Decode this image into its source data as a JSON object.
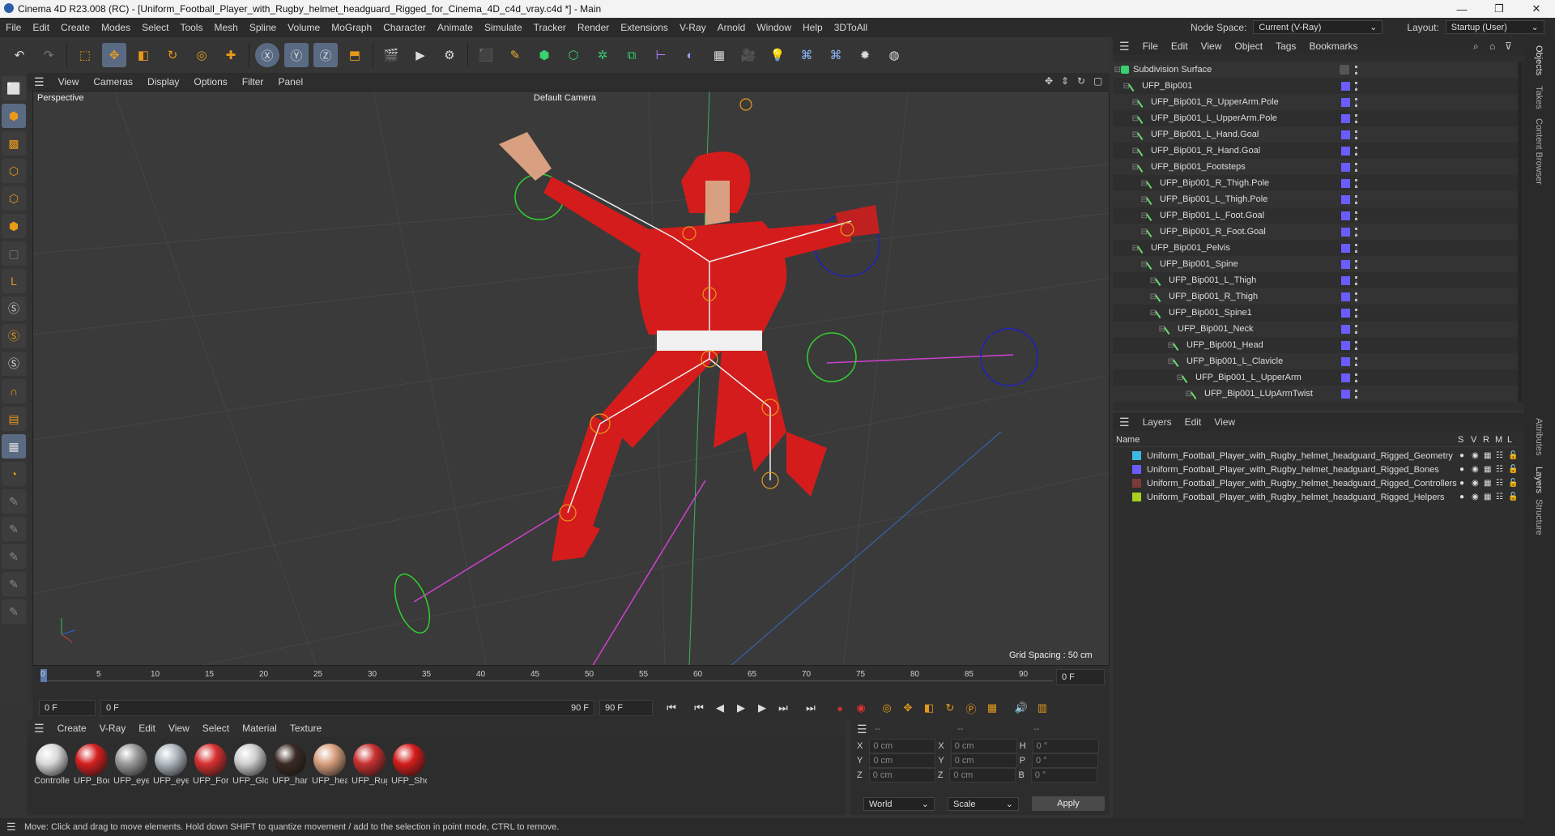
{
  "window": {
    "title": "Cinema 4D R23.008 (RC) - [Uniform_Football_Player_with_Rugby_helmet_headguard_Rigged_for_Cinema_4D_c4d_vray.c4d *] - Main"
  },
  "menu": [
    "File",
    "Edit",
    "Create",
    "Modes",
    "Select",
    "Tools",
    "Mesh",
    "Spline",
    "Volume",
    "MoGraph",
    "Character",
    "Animate",
    "Simulate",
    "Tracker",
    "Render",
    "Extensions",
    "V-Ray",
    "Arnold",
    "Window",
    "Help",
    "3DToAll"
  ],
  "node_space": {
    "label": "Node Space:",
    "value": "Current (V-Ray)"
  },
  "layout": {
    "label": "Layout:",
    "value": "Startup (User)"
  },
  "viewport": {
    "menu": [
      "View",
      "Cameras",
      "Display",
      "Options",
      "Filter",
      "Panel"
    ],
    "mode": "Perspective",
    "camera": "Default Camera",
    "grid_spacing": "Grid Spacing : 50 cm"
  },
  "timeline": {
    "ticks": [
      "0",
      "5",
      "10",
      "15",
      "20",
      "25",
      "30",
      "35",
      "40",
      "45",
      "50",
      "55",
      "60",
      "65",
      "70",
      "75",
      "80",
      "85",
      "90"
    ],
    "current": "0 F"
  },
  "transport": {
    "start": "0 F",
    "preview_start": "0 F",
    "preview_end": "90 F",
    "end": "90 F"
  },
  "materials": {
    "menu": [
      "Create",
      "V-Ray",
      "Edit",
      "View",
      "Select",
      "Material",
      "Texture"
    ],
    "items": [
      {
        "label": "Controlle",
        "color": "#d9d9d9"
      },
      {
        "label": "UFP_Boc",
        "color": "#d42020"
      },
      {
        "label": "UFP_eye",
        "color": "#9a9a9a"
      },
      {
        "label": "UFP_eye",
        "color": "#b0b8c0"
      },
      {
        "label": "UFP_Forr",
        "color": "#d83030"
      },
      {
        "label": "UFP_Glo",
        "color": "#cfcfcf"
      },
      {
        "label": "UFP_han",
        "color": "#3a2a24"
      },
      {
        "label": "UFP_hea",
        "color": "#d8a080"
      },
      {
        "label": "UFP_Rug",
        "color": "#c83030"
      },
      {
        "label": "UFP_Sho",
        "color": "#d41c1c"
      }
    ]
  },
  "coords": {
    "header": [
      "--",
      "--",
      "--"
    ],
    "rows": [
      {
        "a": "X",
        "v1": "0 cm",
        "b": "X",
        "v2": "0 cm",
        "c": "H",
        "v3": "0 °"
      },
      {
        "a": "Y",
        "v1": "0 cm",
        "b": "Y",
        "v2": "0 cm",
        "c": "P",
        "v3": "0 °"
      },
      {
        "a": "Z",
        "v1": "0 cm",
        "b": "Z",
        "v2": "0 cm",
        "c": "B",
        "v3": "0 °"
      }
    ],
    "world": "World",
    "scale": "Scale",
    "apply": "Apply"
  },
  "status": "Move: Click and drag to move elements. Hold down SHIFT to quantize movement / add to the selection in point mode, CTRL to remove.",
  "objects": {
    "menu": [
      "File",
      "Edit",
      "View",
      "Object",
      "Tags",
      "Bookmarks"
    ],
    "items": [
      {
        "label": "Subdivision Surface",
        "depth": 0
      },
      {
        "label": "UFP_Bip001",
        "depth": 1
      },
      {
        "label": "UFP_Bip001_R_UpperArm.Pole",
        "depth": 2
      },
      {
        "label": "UFP_Bip001_L_UpperArm.Pole",
        "depth": 2
      },
      {
        "label": "UFP_Bip001_L_Hand.Goal",
        "depth": 2
      },
      {
        "label": "UFP_Bip001_R_Hand.Goal",
        "depth": 2
      },
      {
        "label": "UFP_Bip001_Footsteps",
        "depth": 2
      },
      {
        "label": "UFP_Bip001_R_Thigh.Pole",
        "depth": 3
      },
      {
        "label": "UFP_Bip001_L_Thigh.Pole",
        "depth": 3
      },
      {
        "label": "UFP_Bip001_L_Foot.Goal",
        "depth": 3
      },
      {
        "label": "UFP_Bip001_R_Foot.Goal",
        "depth": 3
      },
      {
        "label": "UFP_Bip001_Pelvis",
        "depth": 2
      },
      {
        "label": "UFP_Bip001_Spine",
        "depth": 3
      },
      {
        "label": "UFP_Bip001_L_Thigh",
        "depth": 4
      },
      {
        "label": "UFP_Bip001_R_Thigh",
        "depth": 4
      },
      {
        "label": "UFP_Bip001_Spine1",
        "depth": 4
      },
      {
        "label": "UFP_Bip001_Neck",
        "depth": 5
      },
      {
        "label": "UFP_Bip001_Head",
        "depth": 6
      },
      {
        "label": "UFP_Bip001_L_Clavicle",
        "depth": 6
      },
      {
        "label": "UFP_Bip001_L_UpperArm",
        "depth": 7
      },
      {
        "label": "UFP_Bip001_LUpArmTwist",
        "depth": 8
      }
    ]
  },
  "layers": {
    "menu": [
      "Layers",
      "Edit",
      "View"
    ],
    "columns": [
      "Name",
      "S",
      "V",
      "R",
      "M",
      "L"
    ],
    "items": [
      {
        "label": "Uniform_Football_Player_with_Rugby_helmet_headguard_Rigged_Geometry",
        "color": "#3db8e0"
      },
      {
        "label": "Uniform_Football_Player_with_Rugby_helmet_headguard_Rigged_Bones",
        "color": "#6b5cff"
      },
      {
        "label": "Uniform_Football_Player_with_Rugby_helmet_headguard_Rigged_Controllers",
        "color": "#7a3a3a"
      },
      {
        "label": "Uniform_Football_Player_with_Rugby_helmet_headguard_Rigged_Helpers",
        "color": "#a8d020"
      }
    ]
  },
  "side_tabs": [
    "Objects",
    "Takes",
    "Content Browser",
    "Attributes",
    "Layers",
    "Structure"
  ]
}
